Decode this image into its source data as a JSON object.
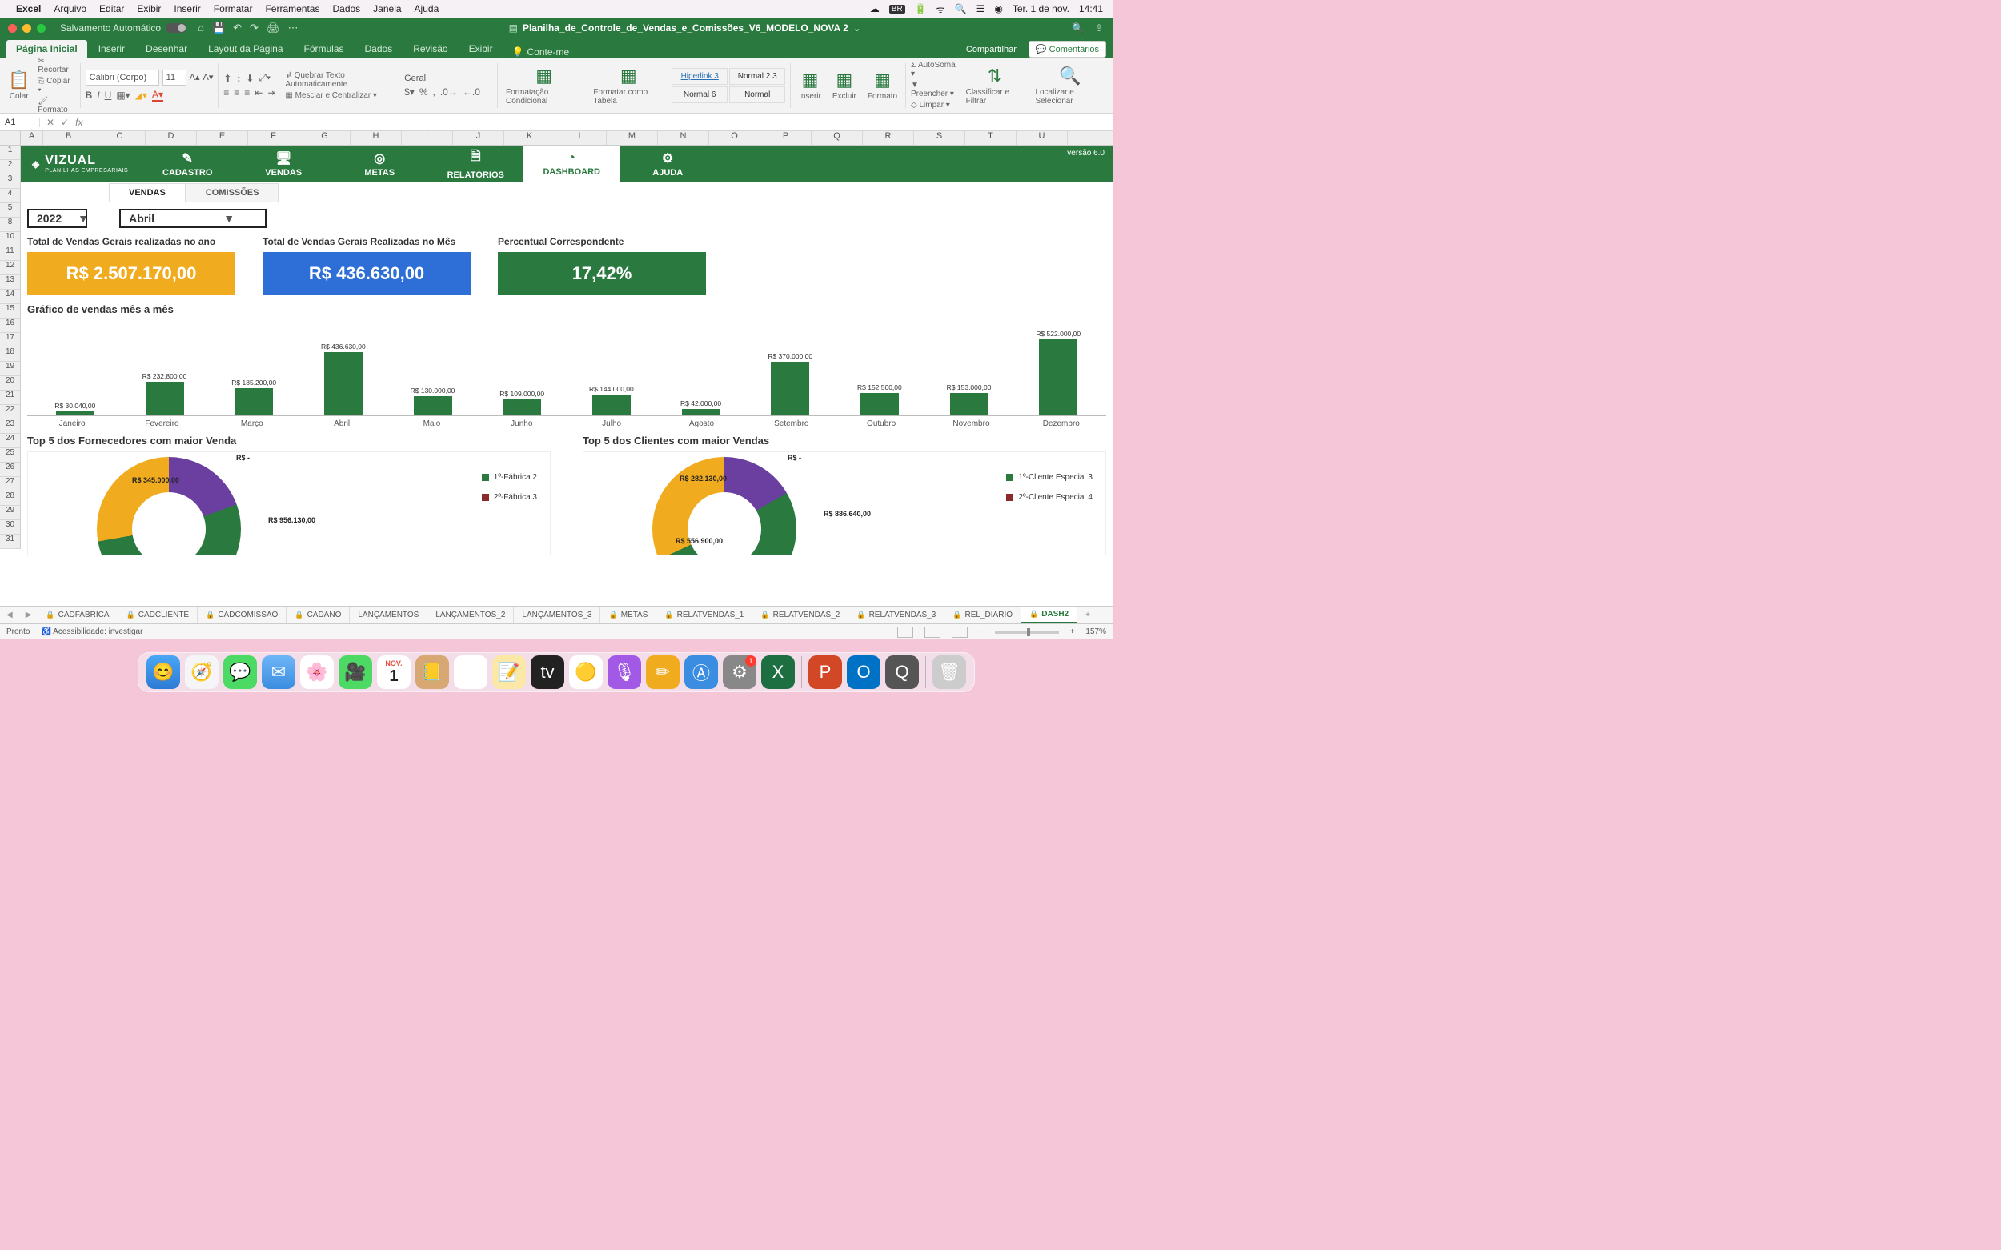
{
  "mac_menu": {
    "app": "Excel",
    "items": [
      "Arquivo",
      "Editar",
      "Exibir",
      "Inserir",
      "Formatar",
      "Ferramentas",
      "Dados",
      "Janela",
      "Ajuda"
    ],
    "date": "Ter. 1 de nov.",
    "time": "14:41",
    "lang": "BR"
  },
  "titlebar": {
    "autosave": "Salvamento Automático",
    "filename": "Planilha_de_Controle_de_Vendas_e_Comissões_V6_MODELO_NOVA 2"
  },
  "ribbon_tabs": [
    "Página Inicial",
    "Inserir",
    "Desenhar",
    "Layout da Página",
    "Fórmulas",
    "Dados",
    "Revisão",
    "Exibir"
  ],
  "tellme": "Conte-me",
  "share": "Compartilhar",
  "comments": "Comentários",
  "ribbon": {
    "paste": "Colar",
    "cut": "Recortar",
    "copy": "Copiar",
    "format": "Formato",
    "font_name": "Calibri (Corpo)",
    "font_size": "11",
    "wrap": "Quebrar Texto Automaticamente",
    "merge": "Mesclar e Centralizar",
    "number_format": "Geral",
    "cond_format": "Formatação Condicional",
    "as_table": "Formatar como Tabela",
    "styles": [
      "Hiperlink 3",
      "Normal 2 3",
      "Normal 6",
      "Normal"
    ],
    "insert": "Inserir",
    "delete": "Excluir",
    "format_cells": "Formato",
    "autosum": "AutoSoma",
    "fill": "Preencher",
    "clear": "Limpar",
    "sort": "Classificar e Filtrar",
    "find": "Localizar e Selecionar"
  },
  "namebox": "A1",
  "columns": [
    "A",
    "B",
    "C",
    "D",
    "E",
    "F",
    "G",
    "H",
    "I",
    "J",
    "K",
    "L",
    "M",
    "N",
    "O",
    "P",
    "Q",
    "R",
    "S",
    "T",
    "U"
  ],
  "rows": [
    "1",
    "2",
    "3",
    "4",
    "5",
    "8",
    "10",
    "11",
    "12",
    "13",
    "14",
    "15",
    "16",
    "17",
    "18",
    "19",
    "20",
    "21",
    "22",
    "23",
    "24",
    "25",
    "26",
    "27",
    "28",
    "29",
    "30",
    "31"
  ],
  "dash": {
    "logo": "VIZUAL",
    "logo_sub": "PLANILHAS EMPRESARIAIS",
    "version": "versão 6.0",
    "nav": [
      {
        "label": "CADASTRO",
        "icon": "✎"
      },
      {
        "label": "VENDAS",
        "icon": "🖥"
      },
      {
        "label": "METAS",
        "icon": "◎"
      },
      {
        "label": "RELATÓRIOS",
        "icon": "🗎"
      },
      {
        "label": "DASHBOARD",
        "icon": "◔"
      },
      {
        "label": "AJUDA",
        "icon": "⚙"
      }
    ],
    "subtabs": [
      "VENDAS",
      "COMISSÕES"
    ],
    "filter_year": "2022",
    "filter_month": "Abril",
    "kpis": [
      {
        "title": "Total de Vendas Gerais realizadas no ano",
        "value": "R$ 2.507.170,00",
        "class": "y"
      },
      {
        "title": "Total de Vendas Gerais Realizadas no Mês",
        "value": "R$ 436.630,00",
        "class": "b"
      },
      {
        "title": "Percentual Correspondente",
        "value": "17,42%",
        "class": "g"
      }
    ],
    "bar_title": "Gráfico de vendas mês a mês",
    "donut1_title": "Top 5 dos Fornecedores com maior Venda",
    "donut2_title": "Top 5 dos Clientes com maior Vendas",
    "donut1_legend": [
      "1º-Fábrica 2",
      "2º-Fábrica 3"
    ],
    "donut2_legend": [
      "1º-Cliente Especial 3",
      "2º-Cliente Especial 4"
    ],
    "donut1_labels": {
      "a": "R$ -",
      "b": "R$ 345.000,00",
      "c": "R$ 956.130,00"
    },
    "donut2_labels": {
      "a": "R$ -",
      "b": "R$ 282.130,00",
      "c": "R$ 886.640,00",
      "d": "R$ 556.900,00"
    }
  },
  "chart_data": {
    "type": "bar",
    "title": "Gráfico de vendas mês a mês",
    "xlabel": "",
    "ylabel": "",
    "categories": [
      "Janeiro",
      "Fevereiro",
      "Março",
      "Abril",
      "Maio",
      "Junho",
      "Julho",
      "Agosto",
      "Setembro",
      "Outubro",
      "Novembro",
      "Dezembro"
    ],
    "values": [
      30040,
      232800,
      185200,
      436630,
      130000,
      109000,
      144000,
      42000,
      370000,
      152500,
      153000,
      522000
    ],
    "value_labels": [
      "R$ 30.040,00",
      "R$ 232.800,00",
      "R$ 185.200,00",
      "R$ 436.630,00",
      "R$ 130.000,00",
      "R$ 109.000,00",
      "R$ 144.000,00",
      "R$ 42.000,00",
      "R$ 370.000,00",
      "R$ 152.500,00",
      "R$ 153.000,00",
      "R$ 522.000,00"
    ],
    "ylim": [
      0,
      522000
    ]
  },
  "sheettabs": [
    "CADFABRICA",
    "CADCLIENTE",
    "CADCOMISSAO",
    "CADANO",
    "LANÇAMENTOS",
    "LANÇAMENTOS_2",
    "LANÇAMENTOS_3",
    "METAS",
    "RELATVENDAS_1",
    "RELATVENDAS_2",
    "RELATVENDAS_3",
    "REL_DIARIO",
    "DASH2"
  ],
  "sheettabs_locked": [
    true,
    true,
    true,
    true,
    false,
    false,
    false,
    true,
    true,
    true,
    true,
    true,
    true
  ],
  "status": {
    "ready": "Pronto",
    "access": "Acessibilidade: investigar",
    "zoom": "157%"
  },
  "dock_cal": {
    "month": "NOV.",
    "day": "1"
  }
}
